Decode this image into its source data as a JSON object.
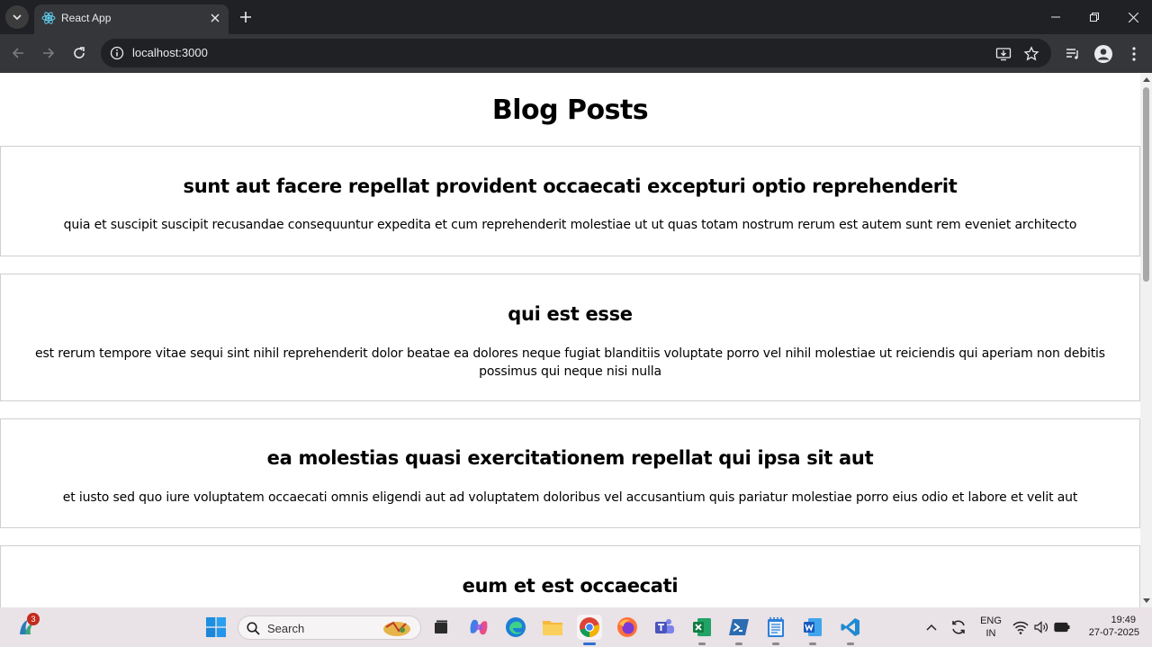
{
  "browser": {
    "tab_title": "React App",
    "url": "localhost:3000"
  },
  "page": {
    "title": "Blog Posts",
    "posts": [
      {
        "title": "sunt aut facere repellat provident occaecati excepturi optio reprehenderit",
        "body": "quia et suscipit suscipit recusandae consequuntur expedita et cum reprehenderit molestiae ut ut quas totam nostrum rerum est autem sunt rem eveniet architecto"
      },
      {
        "title": "qui est esse",
        "body": "est rerum tempore vitae sequi sint nihil reprehenderit dolor beatae ea dolores neque fugiat blanditiis voluptate porro vel nihil molestiae ut reiciendis qui aperiam non debitis possimus qui neque nisi nulla"
      },
      {
        "title": "ea molestias quasi exercitationem repellat qui ipsa sit aut",
        "body": "et iusto sed quo iure voluptatem occaecati omnis eligendi aut ad voluptatem doloribus vel accusantium quis pariatur molestiae porro eius odio et labore et velit aut"
      },
      {
        "title": "eum et est occaecati",
        "body": ""
      }
    ]
  },
  "taskbar": {
    "search_label": "Search",
    "widget_badge": "3",
    "lang_line1": "ENG",
    "lang_line2": "IN",
    "time": "19:49",
    "date": "27-07-2025",
    "icons": [
      "widgets-icon",
      "start-icon",
      "search-icon",
      "task-view-icon",
      "copilot-icon",
      "edge-icon",
      "file-explorer-icon",
      "chrome-icon",
      "firefox-icon",
      "teams-icon",
      "excel-icon",
      "powershell-icon",
      "notepad-icon",
      "word-icon",
      "vscode-icon"
    ]
  },
  "colors": {
    "chrome_dark": "#202124",
    "toolbar": "#35363a",
    "page_bg": "#ffffff",
    "post_border": "#cfcfcf",
    "taskbar": "#e9e2e6"
  }
}
